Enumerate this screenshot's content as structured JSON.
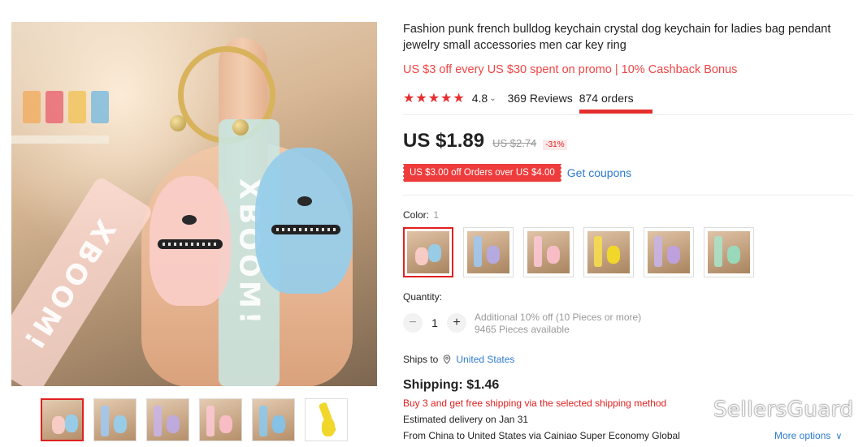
{
  "product": {
    "title": "Fashion punk french bulldog keychain crystal dog keychain for ladies bag pendant jewelry small accessories men car key ring",
    "promo": "US $3 off every US $30 spent on promo | 10% Cashback Bonus",
    "rating": "4.8",
    "reviews": "369 Reviews",
    "orders": "874 orders",
    "star_count": 5,
    "image_strap_text": "XBOOM!"
  },
  "price": {
    "current": "US $1.89",
    "original": "US $2.74",
    "discount": "-31%"
  },
  "coupon": {
    "label": "US $3.00 off Orders over US $4.00",
    "get_coupons": "Get coupons"
  },
  "color": {
    "label": "Color:",
    "count": "1",
    "swatch_names": [
      "pink-blue",
      "blue-purple",
      "pink",
      "yellow",
      "purple",
      "green"
    ]
  },
  "quantity": {
    "label": "Quantity:",
    "value": "1",
    "minus": "−",
    "plus": "+",
    "bulk_discount": "Additional 10% off (10 Pieces or more)",
    "available": "9465 Pieces available"
  },
  "shipping": {
    "ships_to_label": "Ships to",
    "ships_to_country": "United States",
    "title": "Shipping: $1.46",
    "promo": "Buy 3 and get free shipping via the selected shipping method",
    "delivery_prefix": "Estimated delivery on",
    "delivery_date": "Jan 31",
    "from_prefix": "From",
    "from_country": "China",
    "to_word": "to",
    "to_country": "United States",
    "via_text": "via Cainiao Super Economy Global",
    "more_options": "More options"
  },
  "watermark": "SellersGuard",
  "colors": {
    "accent_red": "#e62e2e",
    "link_blue": "#2e7bd0",
    "promo_red": "#f04545"
  }
}
